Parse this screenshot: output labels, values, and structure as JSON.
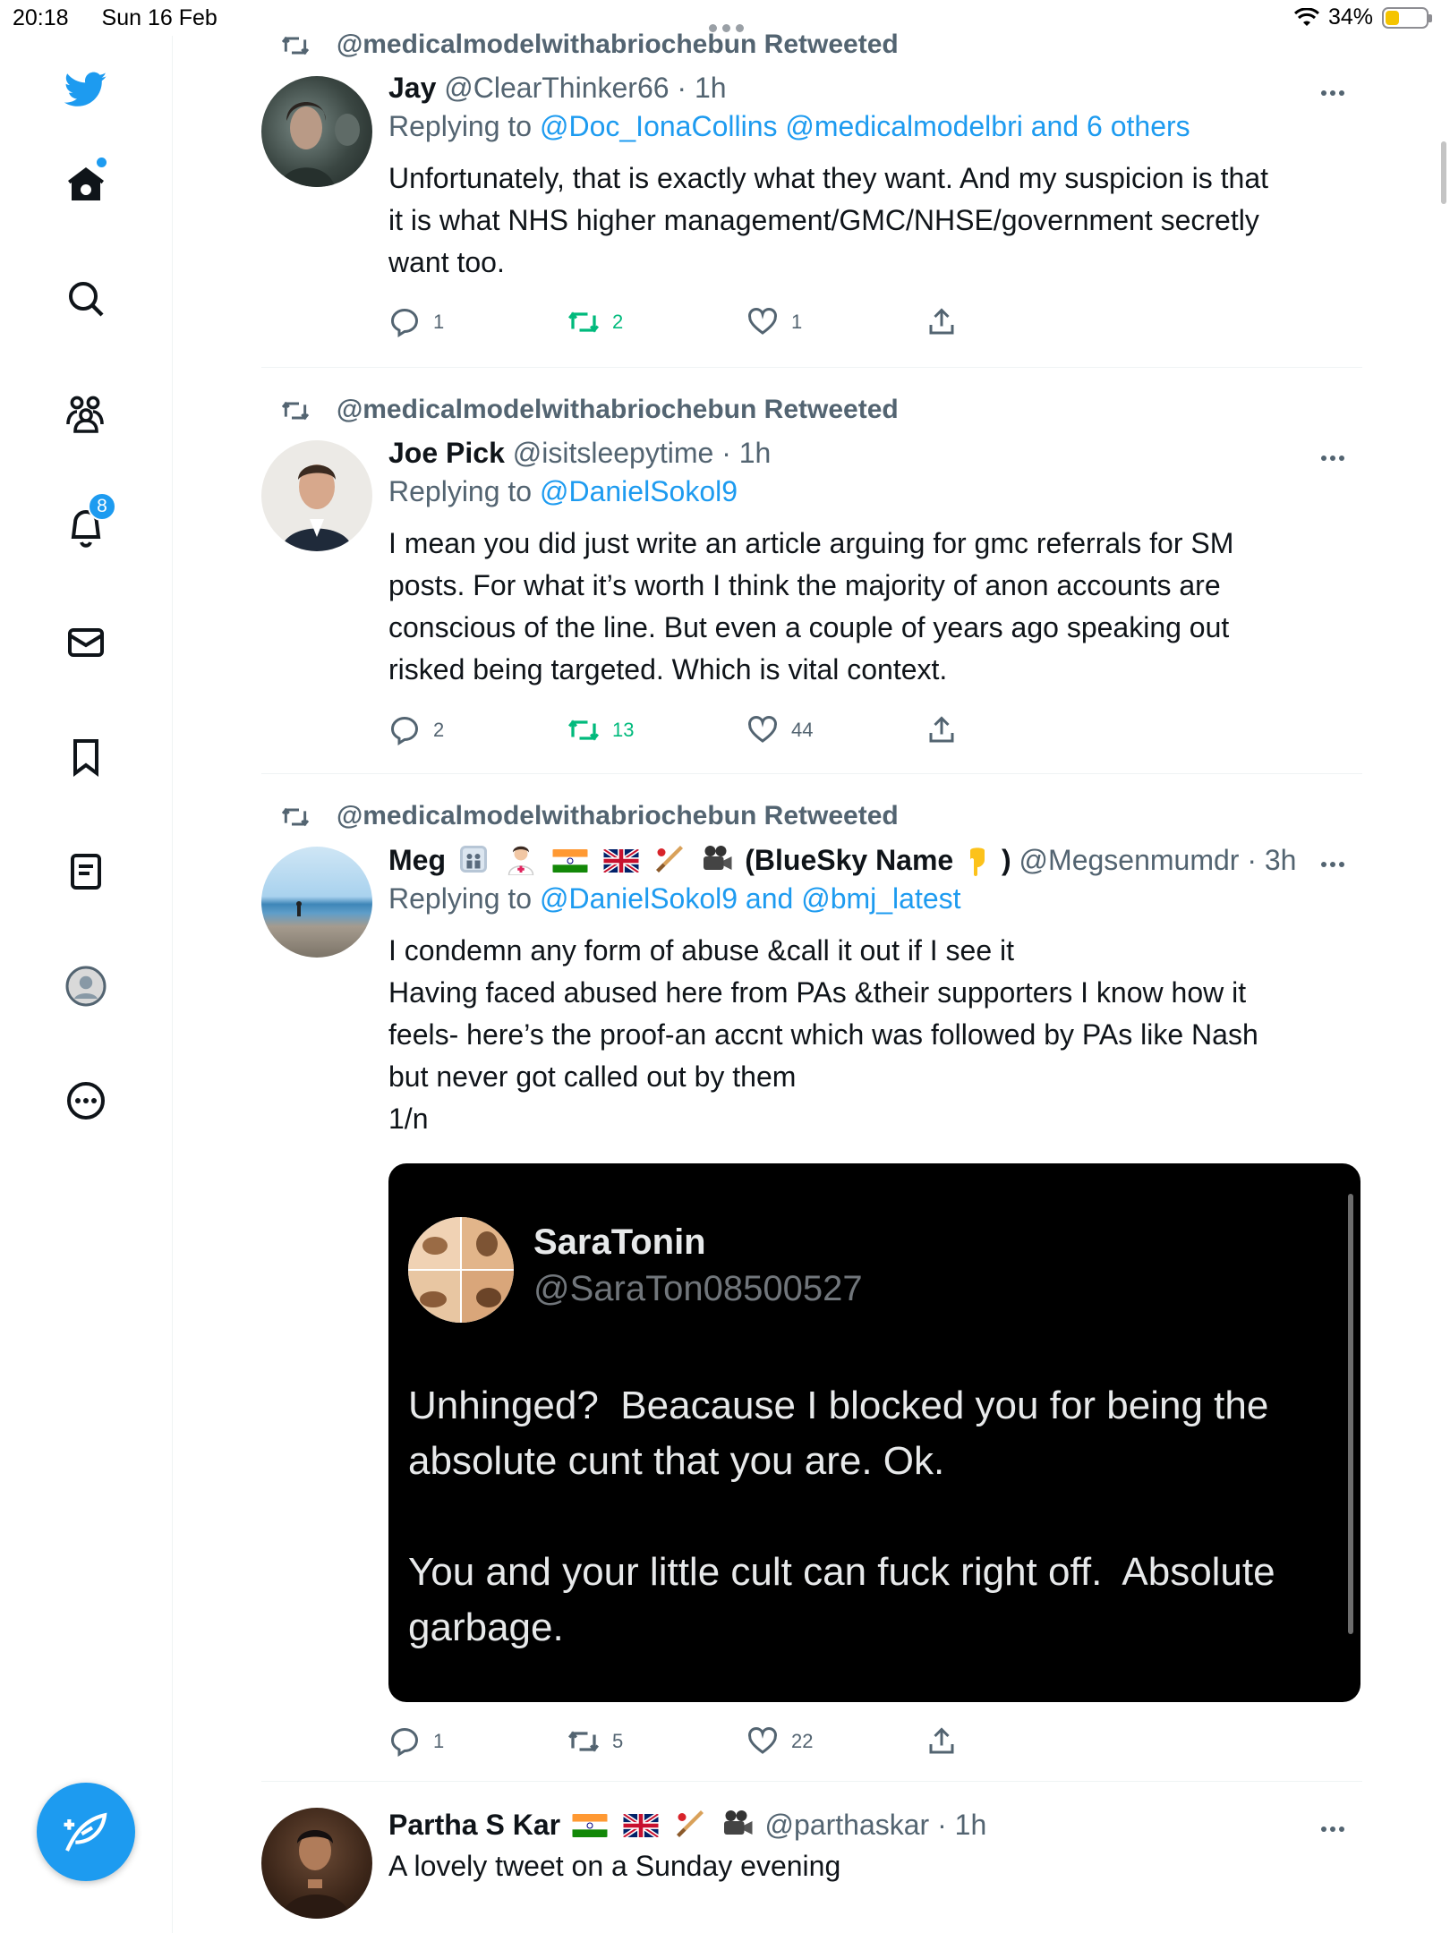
{
  "status_bar": {
    "time": "20:18",
    "date": "Sun 16 Feb",
    "battery": "34%",
    "battery_level": 0.34
  },
  "sidebar": {
    "items": [
      {
        "icon": "twitter-bird-icon"
      },
      {
        "icon": "home-icon"
      },
      {
        "icon": "search-icon"
      },
      {
        "icon": "communities-icon"
      },
      {
        "icon": "notifications-icon",
        "badge": "8"
      },
      {
        "icon": "messages-icon"
      },
      {
        "icon": "bookmarks-icon"
      },
      {
        "icon": "lists-icon"
      },
      {
        "icon": "profile-icon"
      },
      {
        "icon": "more-circle-icon"
      }
    ],
    "compose_icon": "compose-feather-icon"
  },
  "colors": {
    "accent": "#1d9bf0",
    "retweet": "#00ba7c",
    "muted": "#536471"
  },
  "tweets": [
    {
      "retweeted_by": "@medicalmodelwithabriochebun Retweeted",
      "name": "Jay",
      "handle": "@ClearThinker66",
      "time": "· 1h",
      "replying_prefix": "Replying to ",
      "replying_to": "@Doc_IonaCollins @medicalmodelbri and 6 others",
      "text": "Unfortunately, that is exactly what they want. And my suspicion is that\nit is what NHS higher management/GMC/NHSE/government secretly\nwant too.",
      "replies": "1",
      "retweets": "2",
      "likes": "1"
    },
    {
      "retweeted_by": "@medicalmodelwithabriochebun Retweeted",
      "name": "Joe Pick",
      "handle": "@isitsleepytime",
      "time": "· 1h",
      "replying_prefix": "Replying to ",
      "replying_to": "@DanielSokol9",
      "text": "I mean you did just write an article arguing for gmc referrals for SM\nposts. For what it’s worth I think the majority of anon accounts are\nconscious of the line. But even a couple of years ago speaking out\nrisked being targeted. Which is vital context.",
      "replies": "2",
      "retweets": "13",
      "likes": "44"
    },
    {
      "retweeted_by": "@medicalmodelwithabriochebun Retweeted",
      "name": "Meg",
      "name_suffix": "(BlueSky Name",
      "name_close": ")",
      "handle": "@Megsenmumdr",
      "time": "· 3h",
      "replying_prefix": "Replying to ",
      "replying_to": "@DanielSokol9 and @bmj_latest",
      "text": "I condemn any form of abuse &call it out if I see it\nHaving faced abused here from PAs &their supporters I know how it\nfeels- here’s the proof-an accnt which was followed by PAs like Nash\nbut never got called out by them\n1/n",
      "media": {
        "name": "SaraTonin",
        "handle": "@SaraTon08500527",
        "text": "Unhinged?  Beacause I blocked you for being the\nabsolute cunt that you are. Ok.\n\nYou and your little cult can fuck right off.  Absolute\ngarbage."
      },
      "replies": "1",
      "retweets": "5",
      "likes": "22"
    },
    {
      "name": "Partha S Kar",
      "handle": "@parthaskar",
      "time": "· 1h",
      "text": "A lovely tweet on a Sunday evening"
    }
  ]
}
